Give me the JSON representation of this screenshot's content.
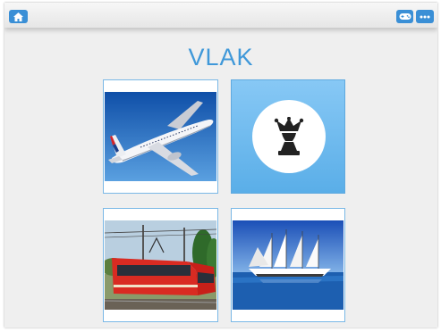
{
  "topbar": {
    "home_icon": "home-icon",
    "game_icon": "gamepad-icon",
    "more_icon": "more-dots-icon"
  },
  "title": "VLAK",
  "cards": [
    {
      "subject": "airplane"
    },
    {
      "subject": "jester-placeholder"
    },
    {
      "subject": "tram"
    },
    {
      "subject": "sailing-ship"
    }
  ],
  "colors": {
    "accent": "#3f98d9",
    "button": "#3a8fd6",
    "selected_card": "#6fbbee"
  }
}
